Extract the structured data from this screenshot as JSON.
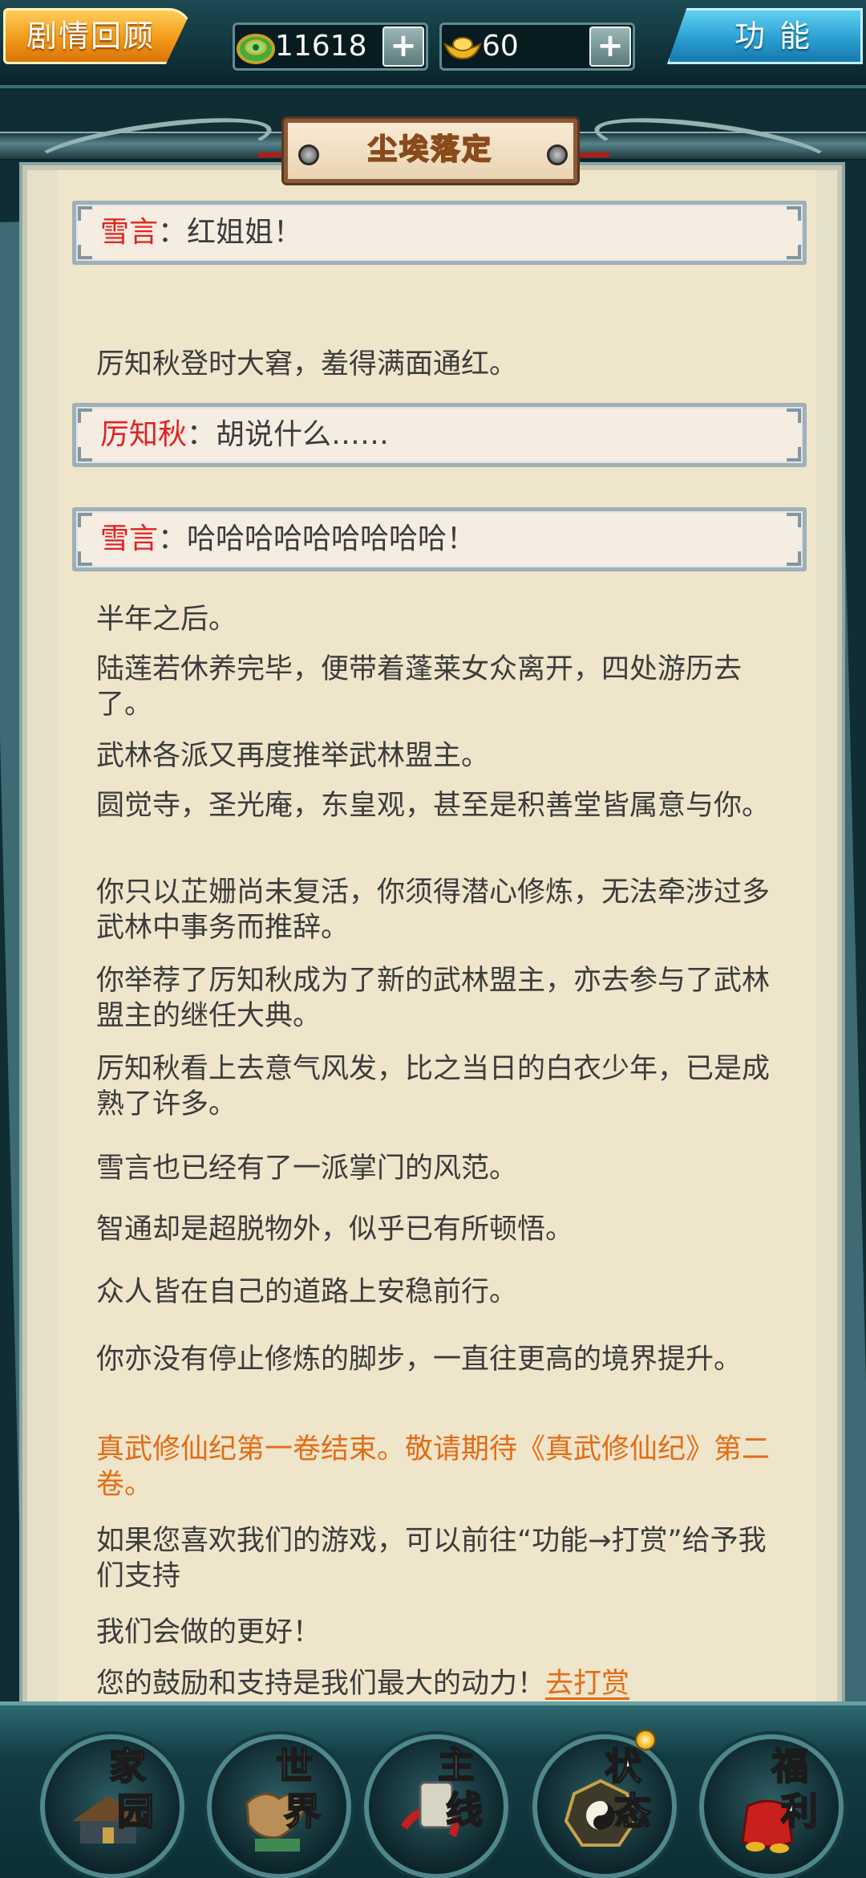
{
  "topbar": {
    "recap_label": "剧情回顾",
    "jade_value": "11618",
    "gold_value": "60",
    "plus_label": "+",
    "function_label": "功能"
  },
  "scroll": {
    "title": "尘埃落定",
    "dialogues": [
      {
        "speaker": "雪言",
        "sep": "：",
        "line": "红姐姐！"
      },
      {
        "speaker": "厉知秋",
        "sep": "：",
        "line": "胡说什么……"
      },
      {
        "speaker": "雪言",
        "sep": "：",
        "line": "哈哈哈哈哈哈哈哈哈！"
      }
    ],
    "narration": [
      "厉知秋登时大窘，羞得满面通红。",
      "半年之后。",
      "陆莲若休养完毕，便带着蓬莱女众离开，四处游历去了。",
      "武林各派又再度推举武林盟主。",
      "圆觉寺，圣光庵，东皇观，甚至是积善堂皆属意与你。",
      "你只以芷姗尚未复活，你须得潜心修炼，无法牵涉过多武林中事务而推辞。",
      "你举荐了厉知秋成为了新的武林盟主，亦去参与了武林盟主的继任大典。",
      "厉知秋看上去意气风发，比之当日的白衣少年，已是成熟了许多。",
      "雪言也已经有了一派掌门的风范。",
      "智通却是超脱物外，似乎已有所顿悟。",
      "众人皆在自己的道路上安稳前行。",
      "你亦没有停止修炼的脚步，一直往更高的境界提升。",
      "真武修仙纪第一卷结束。敬请期待《真武修仙纪》第二卷。",
      "如果您喜欢我们的游戏，可以前往“功能→打赏”给予我们支持",
      "我们会做的更好！",
      "您的鼓励和支持是我们最大的动力！"
    ],
    "reward_link": "去打赏"
  },
  "nav": [
    {
      "a": "家",
      "b": "园"
    },
    {
      "a": "世",
      "b": "界"
    },
    {
      "a": "主",
      "b": "线"
    },
    {
      "a": "状",
      "b": "态"
    },
    {
      "a": "福",
      "b": "利"
    }
  ],
  "colors": {
    "speaker": "#e02222",
    "highlight": "#e46c14",
    "body_text": "#3c3c3c",
    "paper": "#efe5cb"
  }
}
